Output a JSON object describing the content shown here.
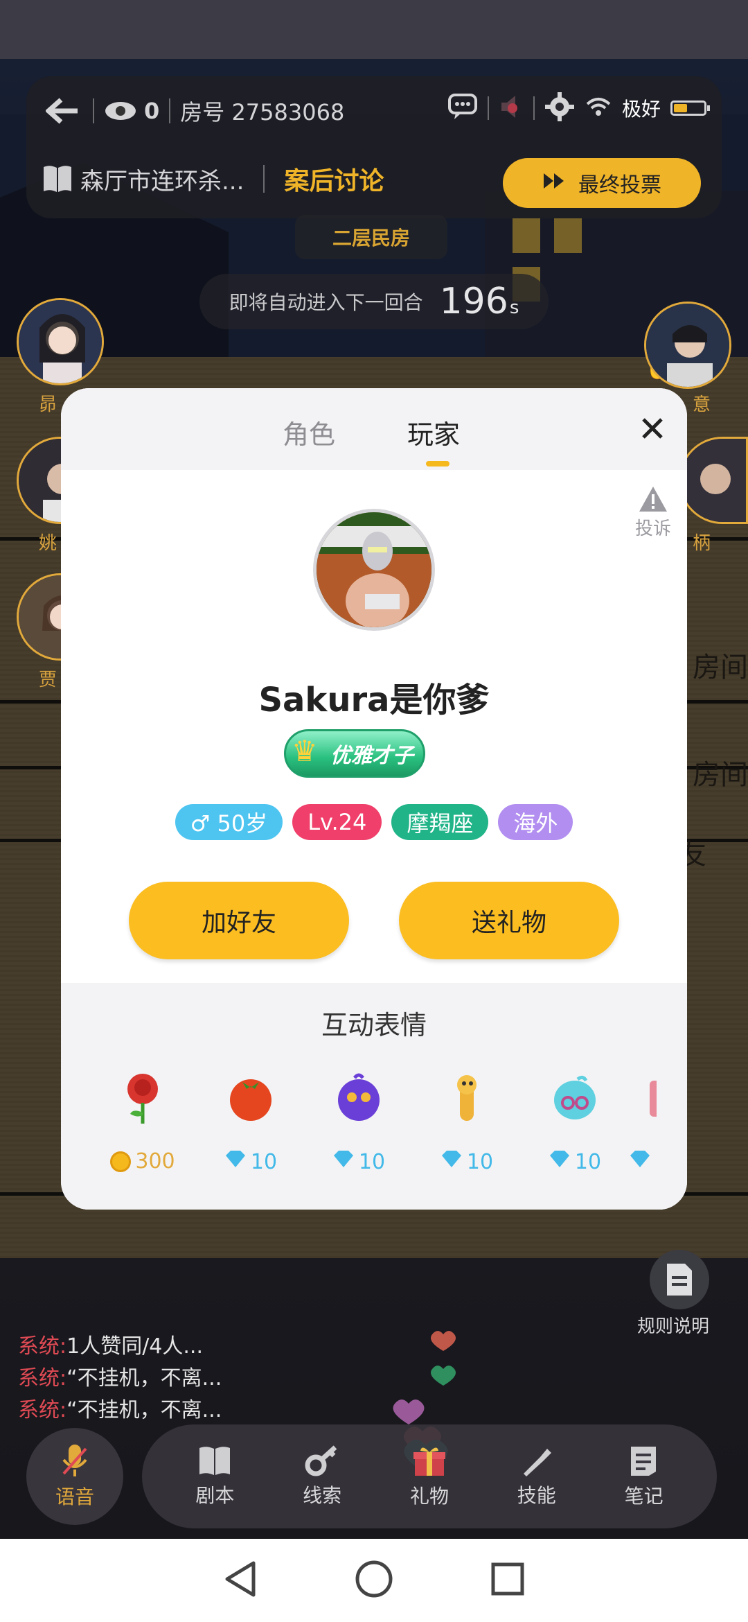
{
  "header": {
    "viewer_count": "0",
    "room_number": "房号 27583068",
    "signal_text": "极好",
    "battery_level": 0.45
  },
  "script_bar": {
    "script_title": "森厅市连环杀...",
    "phase": "案后讨论",
    "vote_button": "最终投票"
  },
  "location": "二层民房",
  "round": {
    "text": "即将自动进入下一回合",
    "seconds": "196",
    "unit": "s"
  },
  "seats": {
    "left": [
      "昴",
      "姚",
      "贾"
    ],
    "right": [
      "意",
      "柄"
    ]
  },
  "side_labels": [
    "房间",
    "房间",
    "友"
  ],
  "chat": [
    {
      "sender": "系统:",
      "text": "1人赞同/4人..."
    },
    {
      "sender": "系统:",
      "text": "“不挂机，不离..."
    },
    {
      "sender": "系统:",
      "text": "“不挂机，不离..."
    }
  ],
  "rules_label": "规则说明",
  "bottom_bar": {
    "voice": "语音",
    "tools": [
      "剧本",
      "线索",
      "礼物",
      "技能",
      "笔记"
    ]
  },
  "modal": {
    "tabs": [
      "角色",
      "玩家"
    ],
    "active_tab": "玩家",
    "report": "投诉",
    "player_name": "Sakura是你爹",
    "title_badge": "优雅才子",
    "tags": {
      "gender_age": "♂ 50岁",
      "level": "Lv.24",
      "zodiac": "摩羯座",
      "region": "海外"
    },
    "add_friend": "加好友",
    "send_gift": "送礼物",
    "emote_title": "互动表情",
    "emotes": [
      {
        "name": "rose",
        "currency": "coin",
        "price": "300"
      },
      {
        "name": "tomato",
        "currency": "gem",
        "price": "10"
      },
      {
        "name": "purple-blob",
        "currency": "gem",
        "price": "10"
      },
      {
        "name": "yellow-creature",
        "currency": "gem",
        "price": "10"
      },
      {
        "name": "blue-blob",
        "currency": "gem",
        "price": "10"
      },
      {
        "name": "partial",
        "currency": "gem",
        "price": ""
      }
    ]
  },
  "colors": {
    "accent": "#f5b81d",
    "level_tag": "#ef3f6a",
    "gender_tag": "#4ec4f0",
    "zodiac_tag": "#20b488",
    "region_tag": "#b18ef0",
    "system_chat": "#e04a54"
  }
}
